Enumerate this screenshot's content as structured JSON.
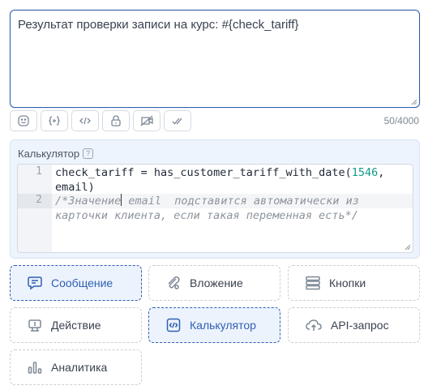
{
  "message": {
    "text": "Результат проверки записи на курс: #{check_tariff}",
    "counter": "50/4000"
  },
  "toolbar": {
    "tools": [
      "emoji-icon",
      "variable-icon",
      "code-icon",
      "lock-icon",
      "no-preview-icon",
      "double-check-icon"
    ]
  },
  "calculator": {
    "title": "Калькулятор",
    "help": "?",
    "line_numbers": [
      "1",
      "2"
    ],
    "line1": {
      "code_a": "check_tariff = has_customer_tariff_with_date(",
      "number": "1546",
      "code_b": ",",
      "code_c": "email)"
    },
    "line2": {
      "comment_a": "/*Значение",
      "comment_b": " email  подставится автоматически из",
      "comment_c": "карточки клиента, если такая переменная есть*/"
    }
  },
  "blocks": [
    {
      "label": "Сообщение",
      "icon": "message-icon",
      "selected": true
    },
    {
      "label": "Вложение",
      "icon": "attachment-icon",
      "selected": false
    },
    {
      "label": "Кнопки",
      "icon": "buttons-icon",
      "selected": false
    },
    {
      "label": "Действие",
      "icon": "action-icon",
      "selected": false
    },
    {
      "label": "Калькулятор",
      "icon": "calculator-code-icon",
      "selected": true
    },
    {
      "label": "API-запрос",
      "icon": "cloud-upload-icon",
      "selected": false
    },
    {
      "label": "Аналитика",
      "icon": "analytics-icon",
      "selected": false
    }
  ],
  "colors": {
    "accent": "#2f5fb3",
    "panel_bg": "#eef4fd",
    "number": "#0f9a8a",
    "comment": "#8d949c"
  }
}
